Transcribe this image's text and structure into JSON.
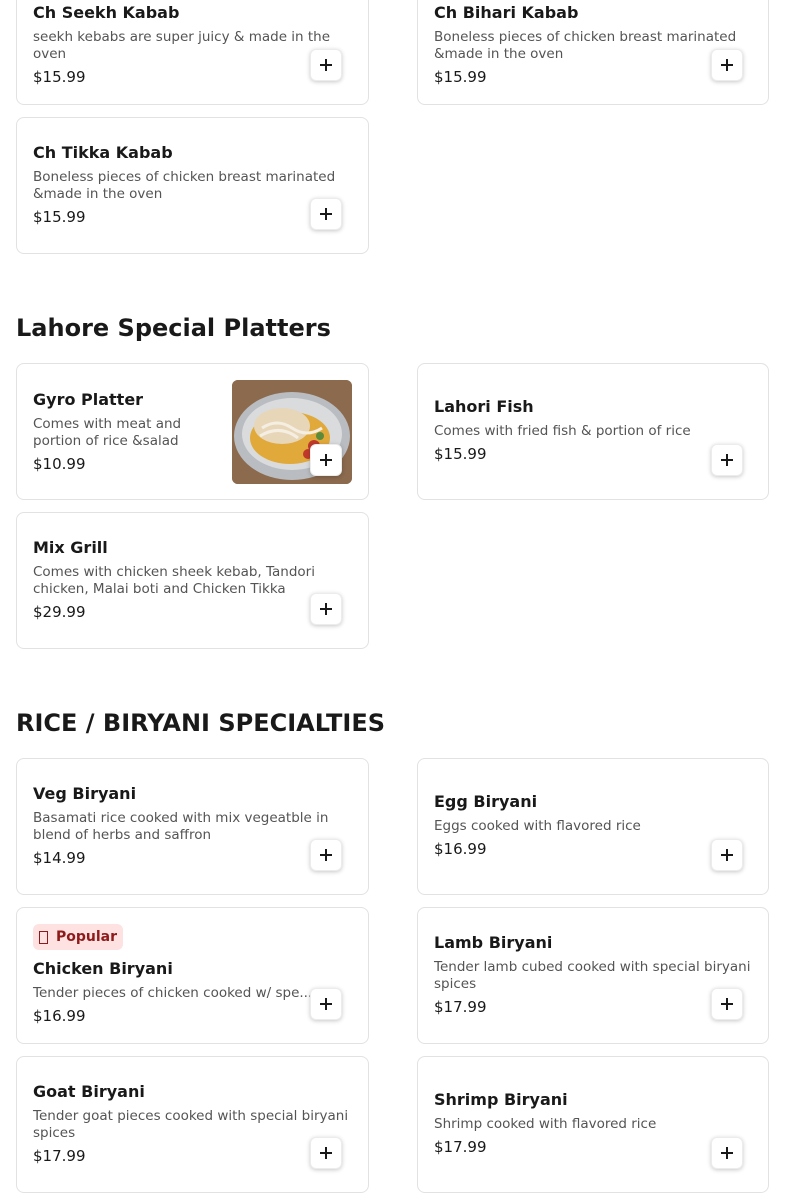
{
  "sections": {
    "platters_title": "Lahore Special Platters",
    "rice_title": "RICE / BIRYANI SPECIALTIES"
  },
  "items": {
    "ch_seekh": {
      "name": "Ch Seekh Kabab",
      "desc": "seekh kebabs are super juicy & made in the oven",
      "price": "$15.99"
    },
    "ch_bihari": {
      "name": "Ch Bihari Kabab",
      "desc": "Boneless pieces of chicken breast marinated &made in the oven",
      "price": "$15.99"
    },
    "ch_tikka": {
      "name": "Ch Tikka Kabab",
      "desc": "Boneless pieces of chicken breast marinated &made in the oven",
      "price": "$15.99"
    },
    "gyro": {
      "name": "Gyro Platter",
      "desc": "Comes with meat and portion of rice &salad",
      "price": "$10.99"
    },
    "lahori_fish": {
      "name": "Lahori Fish",
      "desc": "Comes with fried fish & portion of rice",
      "price": "$15.99"
    },
    "mix_grill": {
      "name": "Mix Grill",
      "desc": "Comes with chicken sheek kebab, Tandori chicken, Malai boti and Chicken Tikka",
      "price": "$29.99"
    },
    "veg_biryani": {
      "name": "Veg Biryani",
      "desc": "Basamati rice cooked with mix vegeatble in blend of herbs and saffron",
      "price": "$14.99"
    },
    "egg_biryani": {
      "name": "Egg Biryani",
      "desc": "Eggs cooked with flavored rice",
      "price": "$16.99"
    },
    "chicken_biryani": {
      "name": "Chicken Biryani",
      "desc": "Tender pieces of chicken cooked w/ spe...",
      "price": "$16.99",
      "badge": "Popular"
    },
    "lamb_biryani": {
      "name": "Lamb Biryani",
      "desc": "Tender lamb cubed cooked with special biryani spices",
      "price": "$17.99"
    },
    "goat_biryani": {
      "name": "Goat Biryani",
      "desc": "Tender goat pieces cooked with special biryani spices",
      "price": "$17.99"
    },
    "shrimp_biryani": {
      "name": "Shrimp Biryani",
      "desc": "Shrimp cooked with flavored rice",
      "price": "$17.99"
    }
  },
  "icons": {
    "add": "plus-icon",
    "popular": "flame-icon"
  },
  "colors": {
    "badge_bg": "#fde2e1",
    "badge_text": "#8e1b1b",
    "text": "#191919",
    "muted": "#545454"
  }
}
